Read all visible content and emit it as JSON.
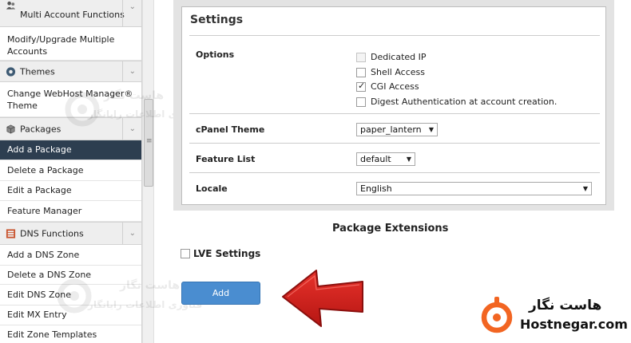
{
  "sidebar": {
    "sections": [
      {
        "label": "Multi Account Functions",
        "icon": "user-group-icon"
      },
      {
        "label": "Themes",
        "icon": "palette-icon"
      },
      {
        "label": "Packages",
        "icon": "box-icon"
      },
      {
        "label": "DNS Functions",
        "icon": "dns-icon"
      }
    ],
    "items": {
      "modify_upgrade": "Modify/Upgrade Multiple Accounts",
      "change_theme": "Change WebHost Manager® Theme",
      "add_package": "Add a Package",
      "delete_package": "Delete a Package",
      "edit_package": "Edit a Package",
      "feature_manager": "Feature Manager",
      "add_dns_zone": "Add a DNS Zone",
      "delete_dns_zone": "Delete a DNS Zone",
      "edit_dns_zone": "Edit DNS Zone",
      "edit_mx_entry": "Edit MX Entry",
      "edit_zone_templates": "Edit Zone Templates"
    },
    "active_item": "Add a Package"
  },
  "settings": {
    "title": "Settings",
    "options_label": "Options",
    "options": [
      {
        "label": "Dedicated IP",
        "checked": false,
        "disabled": true
      },
      {
        "label": "Shell Access",
        "checked": false,
        "disabled": false
      },
      {
        "label": "CGI Access",
        "checked": true,
        "disabled": false
      },
      {
        "label": "Digest Authentication at account creation.",
        "checked": false,
        "disabled": false
      }
    ],
    "cpanel_theme_label": "cPanel Theme",
    "cpanel_theme_value": "paper_lantern",
    "feature_list_label": "Feature List",
    "feature_list_value": "default",
    "locale_label": "Locale",
    "locale_value": "English"
  },
  "extensions": {
    "heading": "Package Extensions",
    "lve_label": "LVE Settings",
    "lve_checked": false
  },
  "add_button": {
    "label": "Add"
  },
  "watermark": {
    "brand_fa": "هاست نگار",
    "tagline_fa": "فناوری اطلاعات رایانگار"
  },
  "logo": {
    "name_fa": "هاست نگار",
    "name_en": "Hostnegar.com",
    "accent_color": "#f26522"
  },
  "colors": {
    "active_item_bg": "#2d3e50",
    "add_button_bg": "#4a8dd0",
    "arrow_red": "#d8231f"
  }
}
